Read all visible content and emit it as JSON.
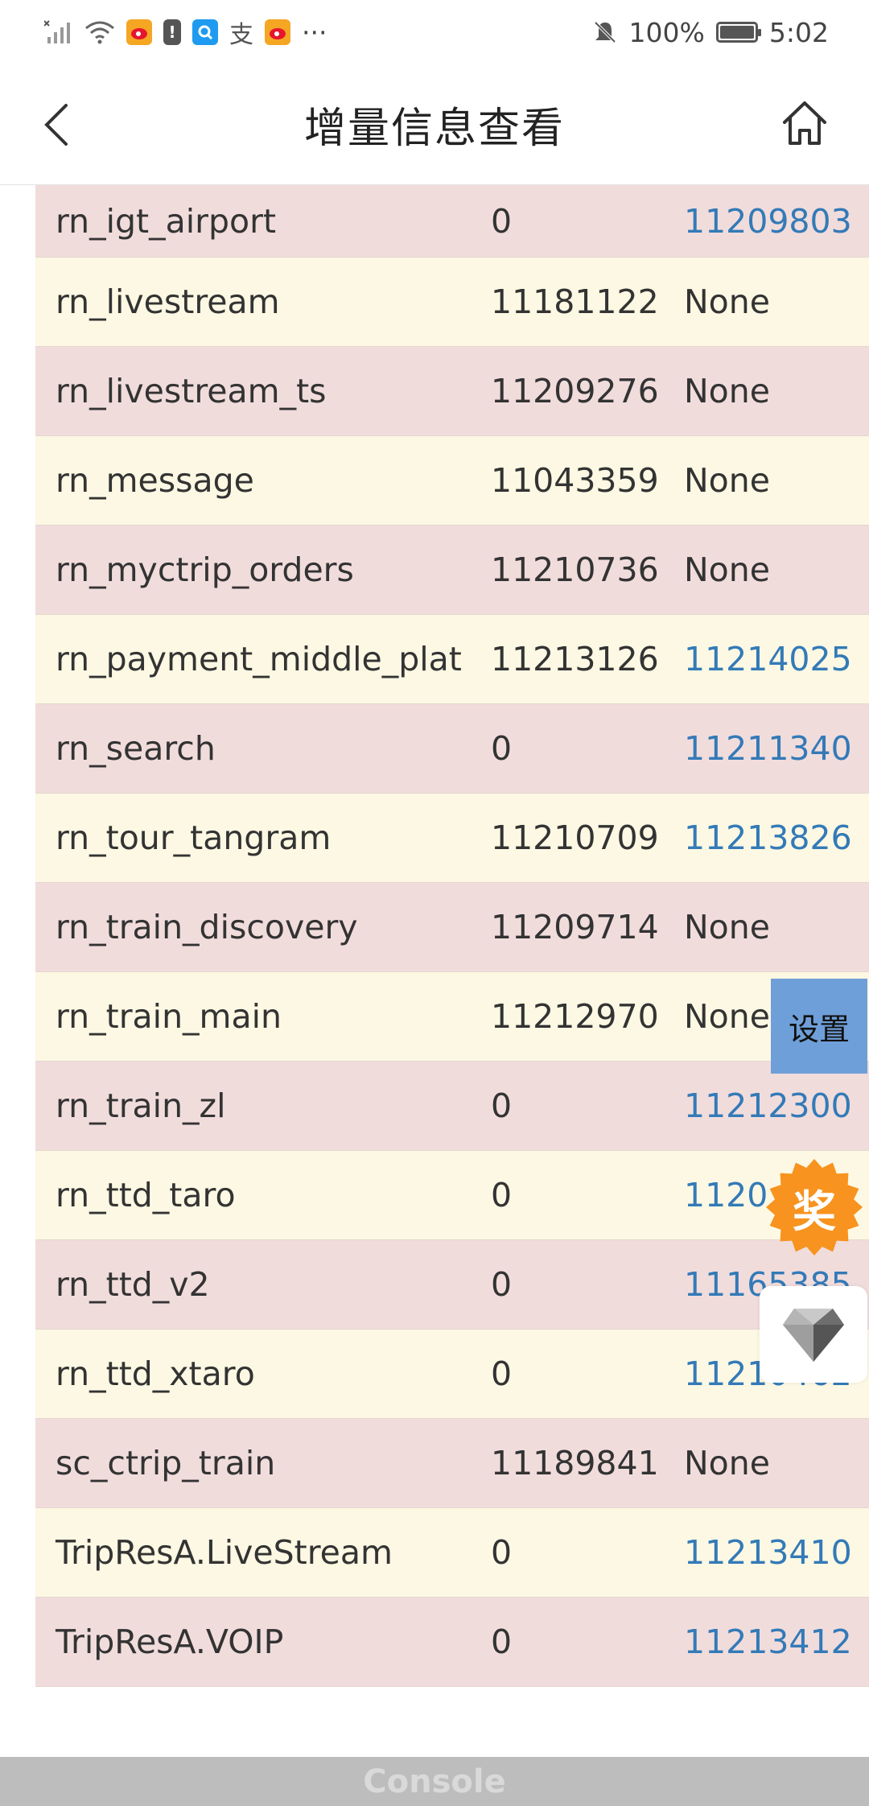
{
  "status_bar": {
    "battery_percent": "100%",
    "time": "5:02",
    "overflow": "···",
    "icons": [
      "signal-icon",
      "wifi-icon",
      "weibo-icon",
      "battery-alert-icon",
      "search-app-icon",
      "alipay-icon",
      "weibo-icon",
      "mute-icon",
      "battery-icon"
    ]
  },
  "header": {
    "title": "增量信息查看",
    "back_icon": "chevron-left-icon",
    "home_icon": "home-icon"
  },
  "table": {
    "rows": [
      {
        "name": "rn_igt_airport",
        "base": "0",
        "new": "11209803",
        "new_is_link": true
      },
      {
        "name": "rn_livestream",
        "base": "11181122",
        "new": "None",
        "new_is_link": false
      },
      {
        "name": "rn_livestream_ts",
        "base": "11209276",
        "new": "None",
        "new_is_link": false
      },
      {
        "name": "rn_message",
        "base": "11043359",
        "new": "None",
        "new_is_link": false
      },
      {
        "name": "rn_myctrip_orders",
        "base": "11210736",
        "new": "None",
        "new_is_link": false
      },
      {
        "name": "rn_payment_middle_plat",
        "base": "11213126",
        "new": "11214025",
        "new_is_link": true
      },
      {
        "name": "rn_search",
        "base": "0",
        "new": "11211340",
        "new_is_link": true
      },
      {
        "name": "rn_tour_tangram",
        "base": "11210709",
        "new": "11213826",
        "new_is_link": true
      },
      {
        "name": "rn_train_discovery",
        "base": "11209714",
        "new": "None",
        "new_is_link": false
      },
      {
        "name": "rn_train_main",
        "base": "11212970",
        "new": "None",
        "new_is_link": false
      },
      {
        "name": "rn_train_zl",
        "base": "0",
        "new": "11212300",
        "new_is_link": true
      },
      {
        "name": "rn_ttd_taro",
        "base": "0",
        "new": "1120",
        "new_is_link": true
      },
      {
        "name": "rn_ttd_v2",
        "base": "0",
        "new": "11165385",
        "new_is_link": true
      },
      {
        "name": "rn_ttd_xtaro",
        "base": "0",
        "new": "11210462",
        "new_is_link": true
      },
      {
        "name": "sc_ctrip_train",
        "base": "11189841",
        "new": "None",
        "new_is_link": false
      },
      {
        "name": "TripResA.LiveStream",
        "base": "0",
        "new": "11213410",
        "new_is_link": true
      },
      {
        "name": "TripResA.VOIP",
        "base": "0",
        "new": "11213412",
        "new_is_link": true
      }
    ]
  },
  "floating": {
    "settings_label": "设置",
    "reward_label": "奖",
    "gem_icon": "gem-icon",
    "reward_color": "#f7931e",
    "settings_color": "#6f9fd8"
  },
  "console": {
    "label": "Console"
  },
  "colors": {
    "row_odd": "#f1dcdc",
    "row_even": "#fcf8e3",
    "link": "#337ab7"
  }
}
